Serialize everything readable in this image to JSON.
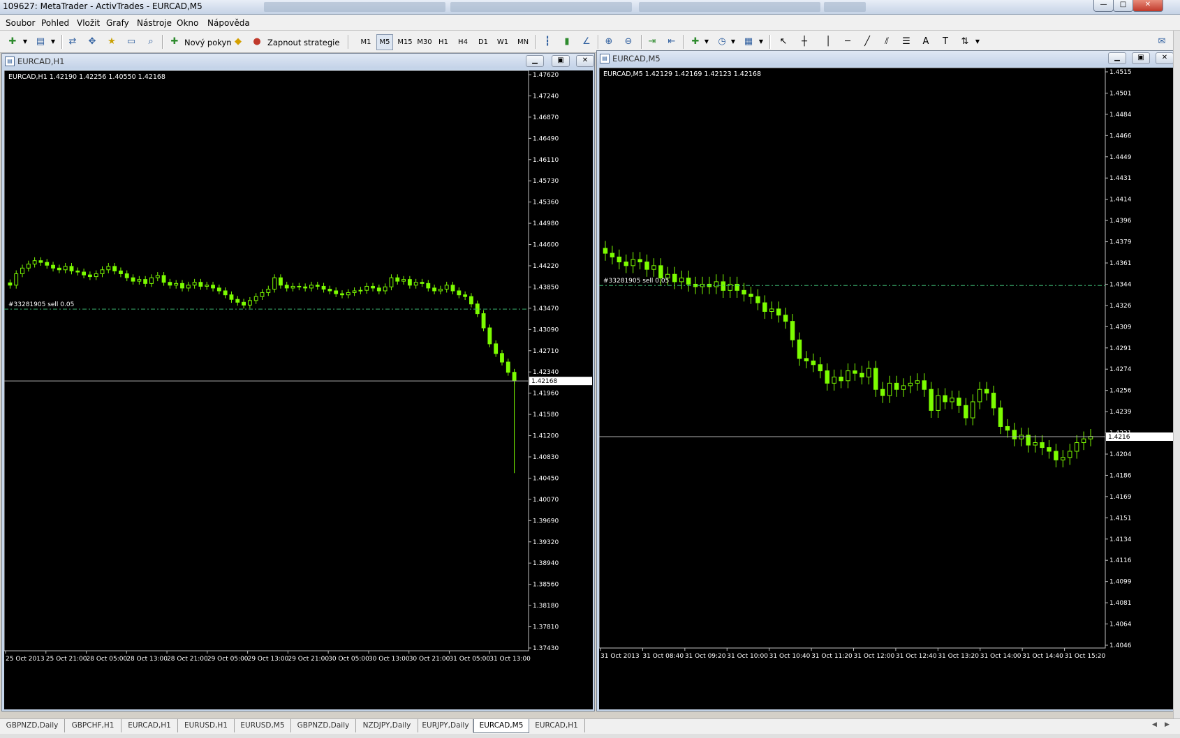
{
  "app": {
    "title": "109627: MetaTrader - ActivTrades - EURCAD,M5",
    "window_controls": {
      "minimize": "—",
      "maximize": "□",
      "close": "✕"
    }
  },
  "menu": [
    "Soubor",
    "Pohled",
    "Vložit",
    "Grafy",
    "Nástroje",
    "Okno",
    "Nápověda"
  ],
  "toolbar": {
    "new_order": "Nový pokyn",
    "strategy": "Zapnout strategie",
    "timeframes": [
      "M1",
      "M5",
      "M15",
      "M30",
      "H1",
      "H4",
      "D1",
      "W1",
      "MN"
    ],
    "active_timeframe": "M5"
  },
  "charts": [
    {
      "window_title": "EURCAD,H1",
      "info": "EURCAD,H1  1.42190 1.42256 1.40550 1.42168",
      "order_label": "#33281905 sell 0.05",
      "current_price_label": "1.42168",
      "y_labels": [
        "1.47620",
        "1.47240",
        "1.46870",
        "1.46490",
        "1.46110",
        "1.45730",
        "1.45360",
        "1.44980",
        "1.44600",
        "1.44220",
        "1.43850",
        "1.43470",
        "1.43090",
        "1.42710",
        "1.42340",
        "1.41960",
        "1.41580",
        "1.41200",
        "1.40830",
        "1.40450",
        "1.40070",
        "1.39690",
        "1.39320",
        "1.38940",
        "1.38560",
        "1.38180",
        "1.37810",
        "1.37430"
      ],
      "x_labels": [
        "25 Oct 2013",
        "25 Oct 21:00",
        "28 Oct 05:00",
        "28 Oct 13:00",
        "28 Oct 21:00",
        "29 Oct 05:00",
        "29 Oct 13:00",
        "29 Oct 21:00",
        "30 Oct 05:00",
        "30 Oct 13:00",
        "30 Oct 21:00",
        "31 Oct 05:00",
        "31 Oct 13:00"
      ]
    },
    {
      "window_title": "EURCAD,M5",
      "info": "EURCAD,M5  1.42129 1.42169 1.42123 1.42168",
      "order_label": "#33281905 sell 0.05",
      "current_price_label": "1.4216",
      "y_labels": [
        "1.4515",
        "1.4501",
        "1.4484",
        "1.4466",
        "1.4449",
        "1.4431",
        "1.4414",
        "1.4396",
        "1.4379",
        "1.4361",
        "1.4344",
        "1.4326",
        "1.4309",
        "1.4291",
        "1.4274",
        "1.4256",
        "1.4239",
        "1.4221",
        "1.4204",
        "1.4186",
        "1.4169",
        "1.4151",
        "1.4134",
        "1.4116",
        "1.4099",
        "1.4081",
        "1.4064",
        "1.4046"
      ],
      "x_labels": [
        "31 Oct 2013",
        "31 Oct 08:40",
        "31 Oct 09:20",
        "31 Oct 10:00",
        "31 Oct 10:40",
        "31 Oct 11:20",
        "31 Oct 12:00",
        "31 Oct 12:40",
        "31 Oct 13:20",
        "31 Oct 14:00",
        "31 Oct 14:40",
        "31 Oct 15:20"
      ]
    }
  ],
  "tabs": [
    "GBPNZD,Daily",
    "GBPCHF,H1",
    "EURCAD,H1",
    "EURUSD,H1",
    "EURUSD,M5",
    "GBPNZD,Daily",
    "NZDJPY,Daily",
    "EURJPY,Daily",
    "EURCAD,M5",
    "EURCAD,H1"
  ],
  "active_tab_index": 8,
  "colors": {
    "chart_bg": "#000000",
    "candle": "#7cfc00",
    "grid_text": "#ffffff",
    "order_line": "#3cb371"
  },
  "chart_data": [
    {
      "type": "candlestick",
      "symbol": "EURCAD",
      "timeframe": "H1",
      "ylim": [
        1.3743,
        1.4762
      ],
      "current_price": 1.42168,
      "order_price": 1.4343,
      "closes": [
        1.4385,
        1.4405,
        1.4415,
        1.4422,
        1.4428,
        1.4425,
        1.442,
        1.4415,
        1.4412,
        1.4418,
        1.441,
        1.4408,
        1.4403,
        1.44,
        1.4405,
        1.4412,
        1.4418,
        1.441,
        1.4405,
        1.4398,
        1.4392,
        1.4395,
        1.4388,
        1.4398,
        1.4402,
        1.439,
        1.4385,
        1.4388,
        1.438,
        1.4385,
        1.439,
        1.4383,
        1.4385,
        1.438,
        1.4375,
        1.4368,
        1.436,
        1.4355,
        1.435,
        1.4358,
        1.4365,
        1.4372,
        1.4378,
        1.4398,
        1.4385,
        1.438,
        1.4383,
        1.4382,
        1.438,
        1.4385,
        1.4383,
        1.4378,
        1.4375,
        1.437,
        1.4368,
        1.4372,
        1.4375,
        1.4376,
        1.4383,
        1.438,
        1.4375,
        1.4382,
        1.4398,
        1.4392,
        1.4395,
        1.4385,
        1.439,
        1.4388,
        1.438,
        1.4375,
        1.4378,
        1.4385,
        1.4375,
        1.4368,
        1.4365,
        1.4352,
        1.4335,
        1.431,
        1.4282,
        1.4265,
        1.425,
        1.4232,
        1.4217
      ]
    },
    {
      "type": "candlestick",
      "symbol": "EURCAD",
      "timeframe": "M5",
      "ylim": [
        1.4046,
        1.4515
      ],
      "current_price": 1.42168,
      "order_price": 1.4339,
      "closes": [
        1.4365,
        1.4362,
        1.4358,
        1.4355,
        1.436,
        1.4358,
        1.4352,
        1.4355,
        1.4345,
        1.4348,
        1.4342,
        1.4345,
        1.434,
        1.4338,
        1.434,
        1.4338,
        1.4342,
        1.4335,
        1.434,
        1.4335,
        1.4332,
        1.433,
        1.4325,
        1.4318,
        1.432,
        1.4315,
        1.431,
        1.4295,
        1.428,
        1.4278,
        1.4275,
        1.427,
        1.426,
        1.4265,
        1.4262,
        1.427,
        1.4268,
        1.4265,
        1.4272,
        1.4255,
        1.425,
        1.426,
        1.4255,
        1.4258,
        1.426,
        1.4262,
        1.4255,
        1.4238,
        1.425,
        1.4245,
        1.4248,
        1.4242,
        1.4232,
        1.4245,
        1.4255,
        1.4252,
        1.424,
        1.4225,
        1.4222,
        1.4215,
        1.4218,
        1.421,
        1.4212,
        1.4208,
        1.4205,
        1.4198,
        1.42,
        1.4205,
        1.4212,
        1.4215,
        1.4217
      ]
    }
  ]
}
